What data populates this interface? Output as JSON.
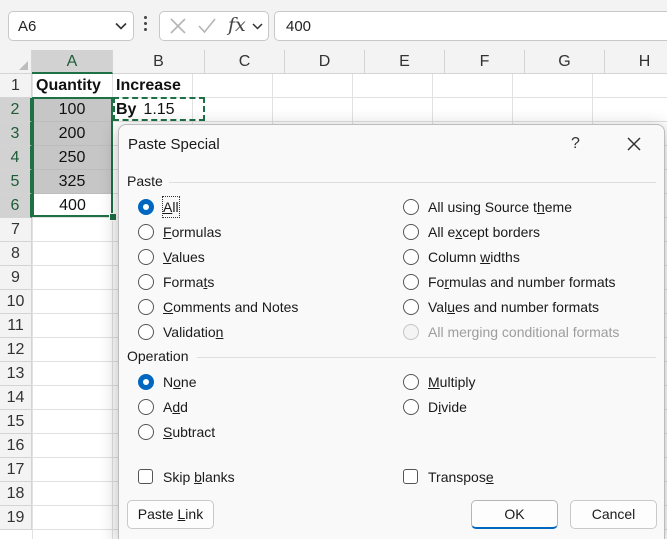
{
  "formula_bar": {
    "name_box": "A6",
    "formula": "400",
    "fx_label": "fx",
    "icons": [
      "chevron-down-icon",
      "cancel-x-icon",
      "confirm-check-icon",
      "chevron-down-icon"
    ]
  },
  "sheet": {
    "columns": [
      "A",
      "B",
      "C",
      "D",
      "E",
      "F",
      "G",
      "H"
    ],
    "rows": [
      "1",
      "2",
      "3",
      "4",
      "5",
      "6",
      "7",
      "8",
      "9",
      "10",
      "11",
      "12",
      "13",
      "14",
      "15",
      "16",
      "17",
      "18",
      "19"
    ],
    "headers": {
      "a1": "Quantity",
      "b1": "Increase By"
    },
    "values": [
      "100",
      "200",
      "250",
      "325",
      "400"
    ],
    "b2": "1.15",
    "active_cell": "A6",
    "selection": "A2:A6",
    "copied_cell": "B2",
    "accent_color": "#1e7145"
  },
  "dialog": {
    "title": "Paste Special",
    "help": "?",
    "paste_section": "Paste",
    "paste_options_left": [
      {
        "pre": "",
        "ul": "A",
        "post": "ll",
        "checked": true
      },
      {
        "pre": "",
        "ul": "F",
        "post": "ormulas",
        "checked": false
      },
      {
        "pre": "",
        "ul": "V",
        "post": "alues",
        "checked": false
      },
      {
        "pre": "Forma",
        "ul": "t",
        "post": "s",
        "checked": false
      },
      {
        "pre": "",
        "ul": "C",
        "post": "omments and Notes",
        "checked": false
      },
      {
        "pre": "Validatio",
        "ul": "n",
        "post": "",
        "checked": false
      }
    ],
    "paste_options_right": [
      {
        "pre": "All using Source t",
        "ul": "h",
        "post": "eme",
        "checked": false,
        "disabled": false
      },
      {
        "pre": "All e",
        "ul": "x",
        "post": "cept borders",
        "checked": false,
        "disabled": false
      },
      {
        "pre": "Column ",
        "ul": "w",
        "post": "idths",
        "checked": false,
        "disabled": false
      },
      {
        "pre": "Fo",
        "ul": "r",
        "post": "mulas and number formats",
        "checked": false,
        "disabled": false
      },
      {
        "pre": "Val",
        "ul": "u",
        "post": "es and number formats",
        "checked": false,
        "disabled": false
      },
      {
        "pre": "All merging conditional formats",
        "ul": "",
        "post": "",
        "checked": false,
        "disabled": true
      }
    ],
    "operation_section": "Operation",
    "operation_left": [
      {
        "pre": "N",
        "ul": "o",
        "post": "ne",
        "checked": true
      },
      {
        "pre": "A",
        "ul": "d",
        "post": "d",
        "checked": false
      },
      {
        "pre": "",
        "ul": "S",
        "post": "ubtract",
        "checked": false
      }
    ],
    "operation_right": [
      {
        "pre": "",
        "ul": "M",
        "post": "ultiply",
        "checked": false
      },
      {
        "pre": "D",
        "ul": "i",
        "post": "vide",
        "checked": false
      }
    ],
    "skip_blanks": {
      "pre": "Skip ",
      "ul": "b",
      "post": "lanks",
      "checked": false
    },
    "transpose": {
      "pre": "Transpos",
      "ul": "e",
      "post": "",
      "checked": false
    },
    "buttons": {
      "paste_link": {
        "pre": "Paste ",
        "ul": "L",
        "post": "ink"
      },
      "ok": "OK",
      "cancel": "Cancel"
    },
    "accent_color": "#0067c0"
  }
}
